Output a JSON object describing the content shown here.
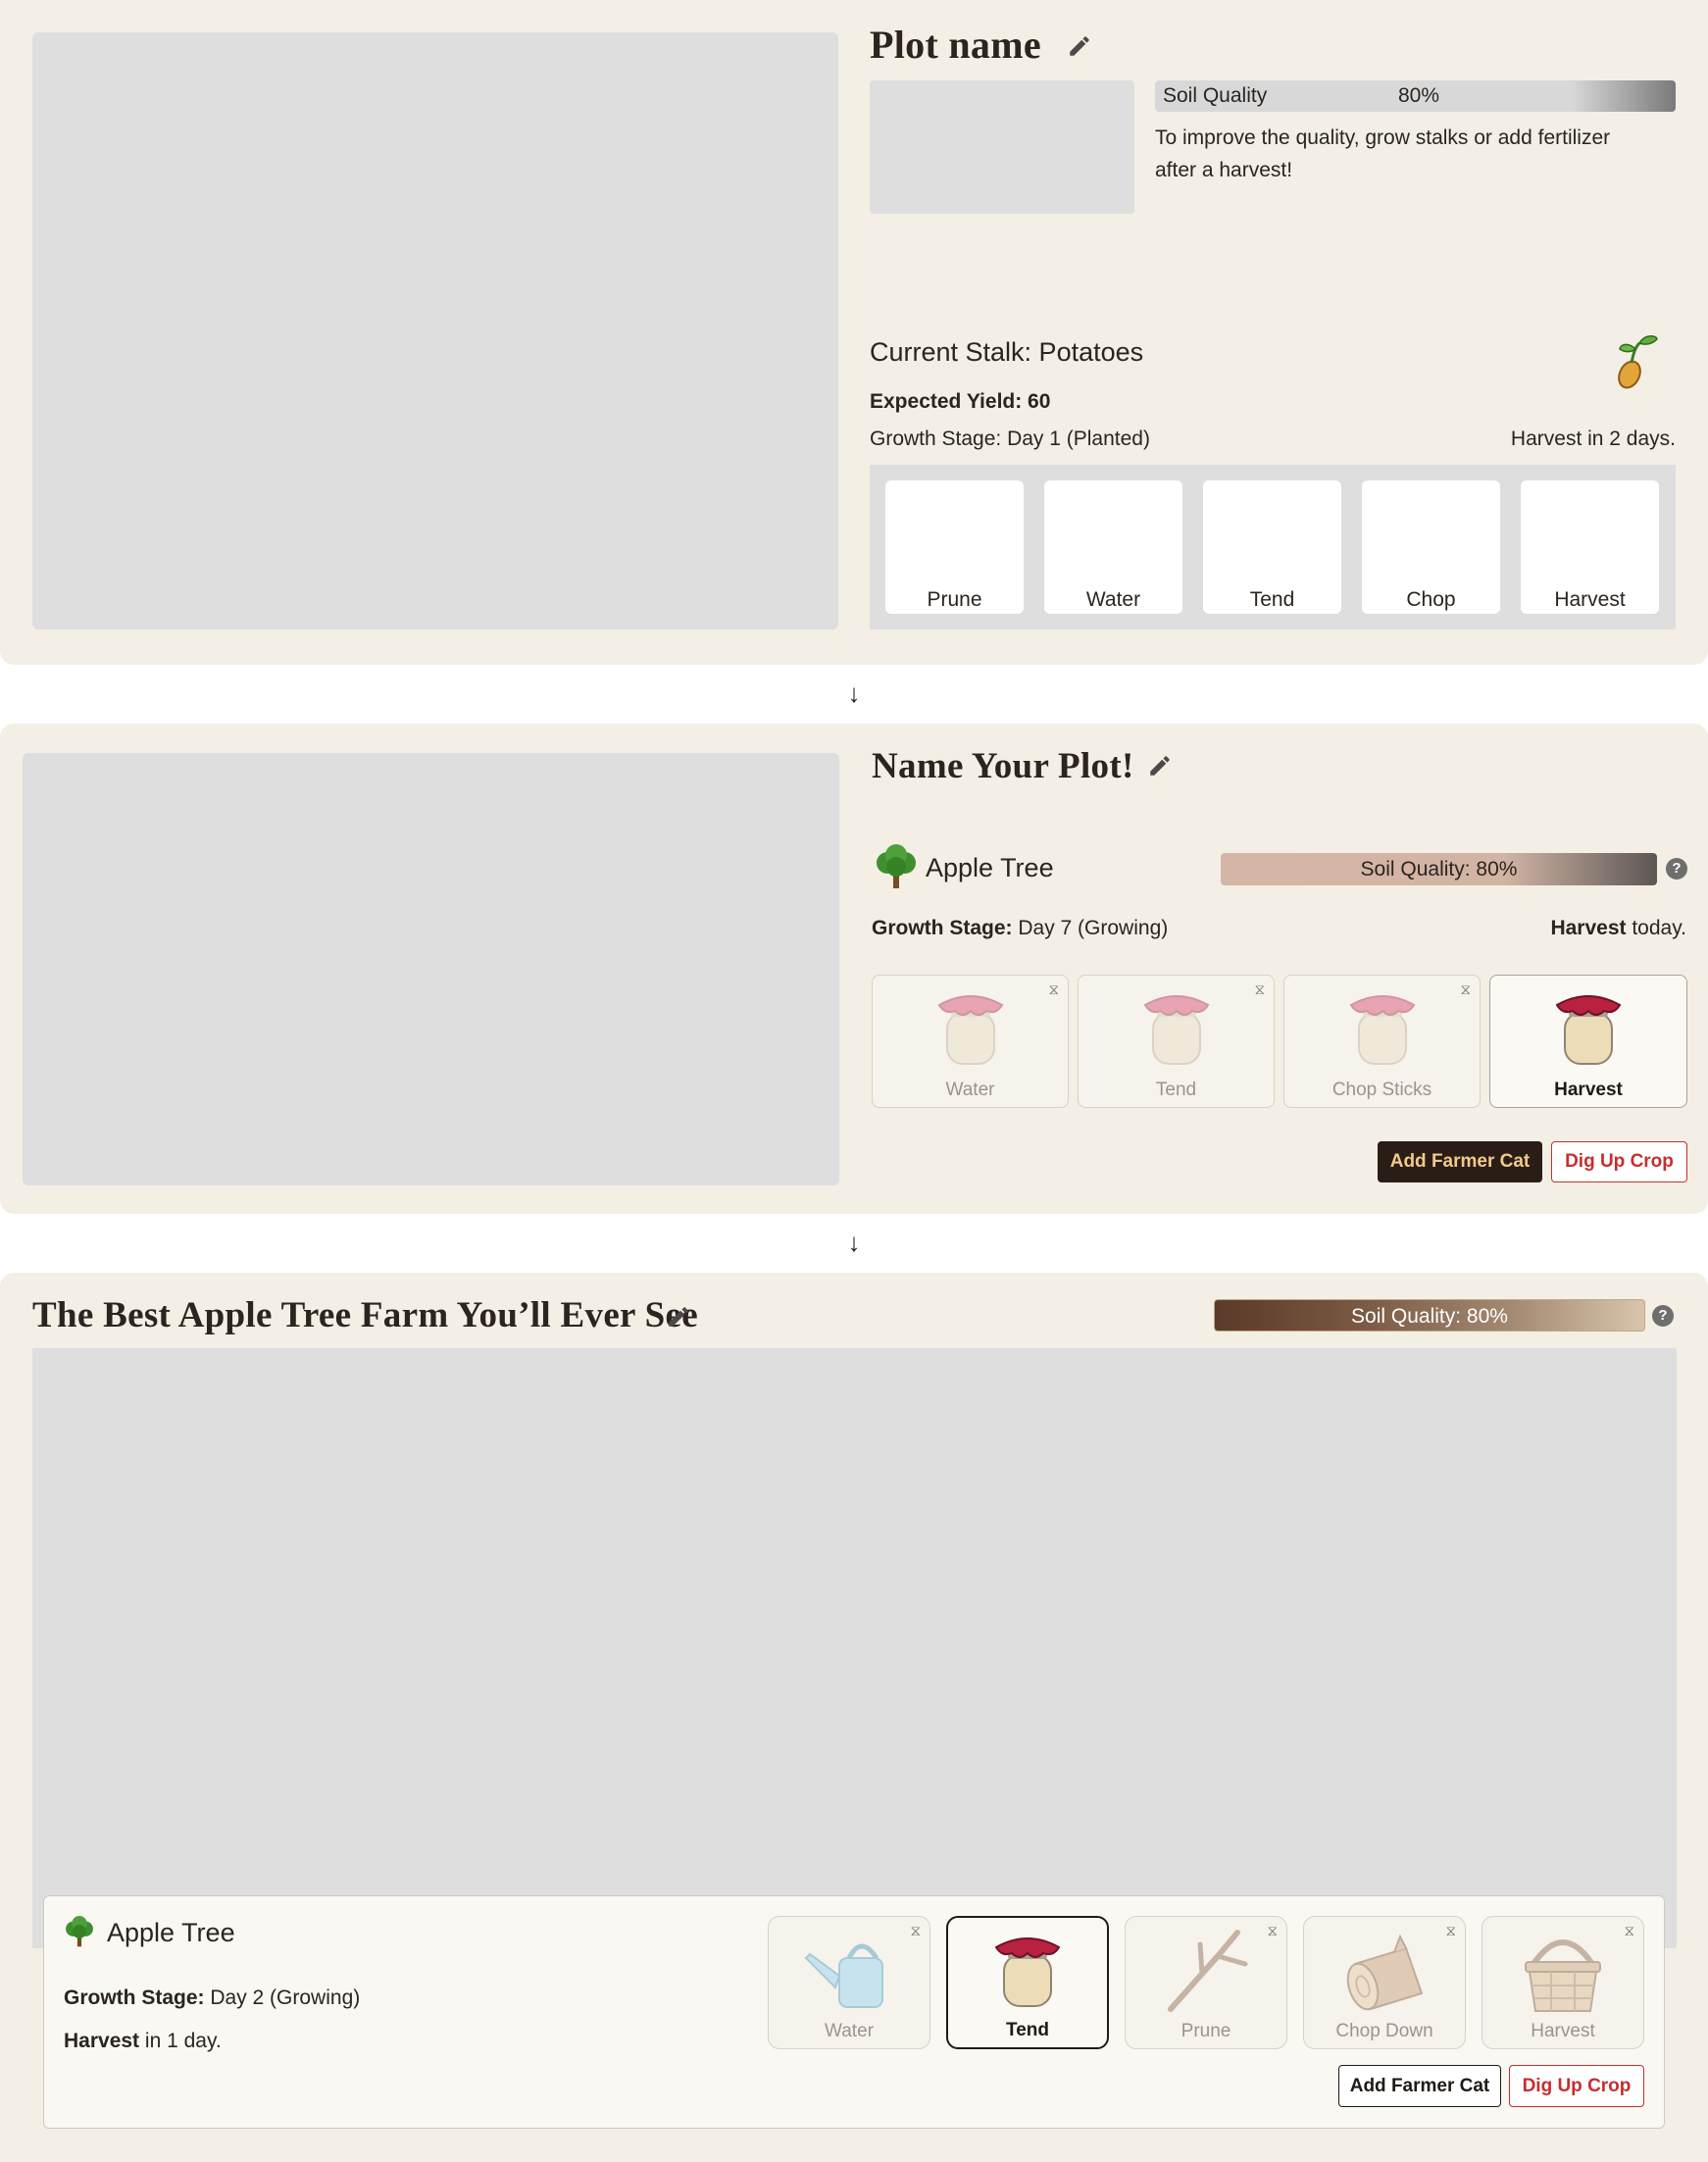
{
  "panel1": {
    "title": "Plot name",
    "soil_label": "Soil Quality",
    "soil_value": "80%",
    "soil_fraction": 0.8,
    "tip": "To improve the quality, grow stalks or add fertilizer",
    "tip_line2": "after a harvest!",
    "stalk_title": "Current Stalk: Potatoes",
    "expected_yield": "Expected Yield: 60",
    "growth_stage": "Growth Stage: Day 1 (Planted)",
    "harvest_in": "Harvest in 2 days.",
    "actions": [
      "Prune",
      "Water",
      "Tend",
      "Chop",
      "Harvest"
    ]
  },
  "panel2": {
    "title": "Name Your Plot!",
    "crop_name": "Apple Tree",
    "soil_text": "Soil Quality: 80%",
    "growth_label": "Growth Stage:",
    "growth_value": "Day 7 (Growing)",
    "harvest_label": "Harvest",
    "harvest_value": "today.",
    "actions": [
      "Water",
      "Tend",
      "Chop Sticks",
      "Harvest"
    ],
    "add_cat": "Add Farmer Cat",
    "dig_up": "Dig Up Crop"
  },
  "panel3": {
    "title": "The Best Apple Tree Farm You’ll Ever See",
    "soil_text": "Soil Quality: 80%",
    "crop_name": "Apple Tree",
    "growth_label": "Growth Stage:",
    "growth_value": "Day 2 (Growing)",
    "harvest_label": "Harvest",
    "harvest_value": "in 1 day.",
    "actions": [
      "Water",
      "Tend",
      "Prune",
      "Chop Down",
      "Harvest"
    ],
    "add_cat": "Add Farmer Cat",
    "dig_up": "Dig Up Crop"
  },
  "arrow": "↓",
  "help": "?",
  "hourglass": "⧖",
  "colors": {
    "panel_bg": "#f3efe5",
    "placeholder": "#dedede",
    "dark_button": "#2a1d16",
    "dark_button_text": "#f3c98b",
    "danger": "#c62e2e"
  },
  "icons": [
    "pencil-icon",
    "sprout-icon",
    "tree-icon",
    "jar-icon",
    "watering-can-icon",
    "stick-icon",
    "log-icon",
    "basket-icon",
    "hourglass-icon",
    "help-icon"
  ]
}
